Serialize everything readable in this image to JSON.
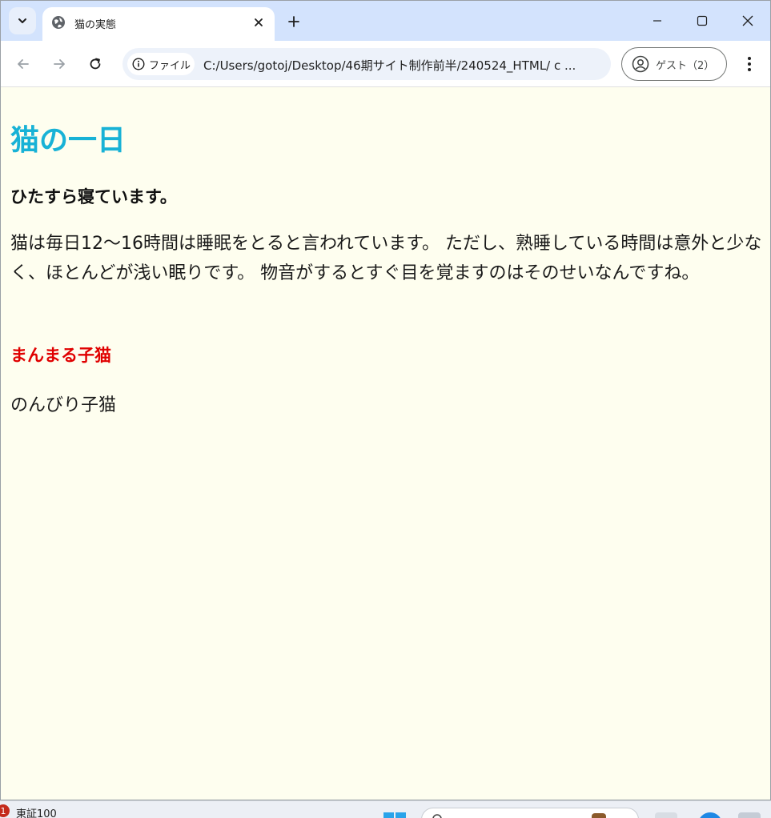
{
  "browser": {
    "tab_title": "猫の実態",
    "omnibox_chip": "ファイル",
    "url": "C:/Users/gotoj/Desktop/46期サイト制作前半/240524_HTML/ c ...",
    "profile_label": "ゲスト（2）"
  },
  "page": {
    "heading": "猫の一日",
    "subheading": "ひたすら寝ています。",
    "paragraph": "猫は毎日12〜16時間は睡眠をとると言われています。 ただし、熟睡している時間は意外と少なく、ほとんどが浅い眠りです。 物音がするとすぐ目を覚ますのはそのせいなんですね。",
    "red_heading": "まんまる子猫",
    "paragraph2": "のんびり子猫"
  },
  "taskbar": {
    "badge_count": "1",
    "stock_label": "東証100"
  },
  "colors": {
    "page_background": "#fefeef",
    "heading": "#18b2d6",
    "red_heading": "#e00000",
    "tabstrip": "#d3e3fd"
  }
}
